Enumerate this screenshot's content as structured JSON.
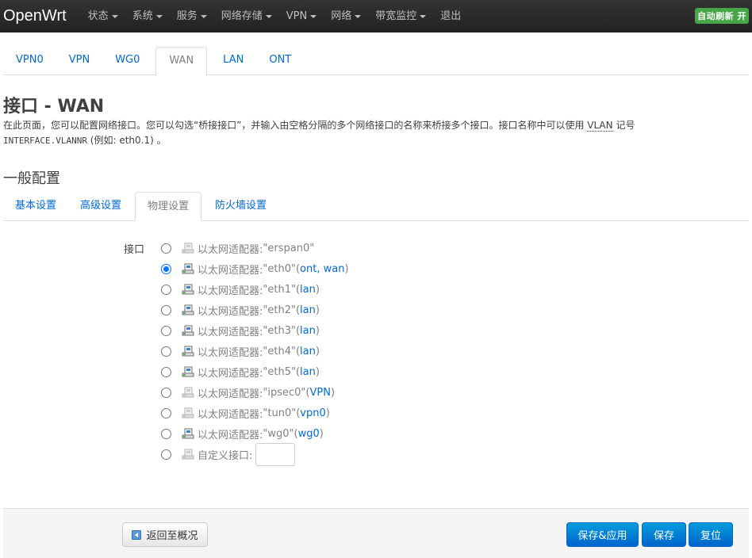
{
  "brand": "OpenWrt",
  "menu": [
    {
      "label": "状态",
      "dropdown": true
    },
    {
      "label": "系统",
      "dropdown": true
    },
    {
      "label": "服务",
      "dropdown": true
    },
    {
      "label": "网络存储",
      "dropdown": true
    },
    {
      "label": "VPN",
      "dropdown": true
    },
    {
      "label": "网络",
      "dropdown": true
    },
    {
      "label": "带宽监控",
      "dropdown": true
    },
    {
      "label": "退出",
      "dropdown": false
    }
  ],
  "autorefresh": "自动刷新 开",
  "interface_tabs": [
    "VPN0",
    "VPN",
    "WG0",
    "WAN",
    "LAN",
    "ONT"
  ],
  "active_interface_tab": "WAN",
  "page_title": "接口 - WAN",
  "description": {
    "part1": "在此页面，您可以配置网络接口。您可以勾选“桥接接口”，并输入由空格分隔的多个网络接口的名称来桥接多个接口。接口名称中可以使用 ",
    "abbr": "VLAN",
    "part2": " 记号",
    "mono": "INTERFACE.VLANNR",
    "part3": " (例如: eth0.1) 。"
  },
  "section_title": "一般配置",
  "sub_tabs": [
    "基本设置",
    "高级设置",
    "物理设置",
    "防火墙设置"
  ],
  "active_sub_tab": "物理设置",
  "field_label": "接口",
  "adapter_prefix": "以太网适配器: ",
  "options": [
    {
      "name": "\"erspan0\"",
      "nets": "",
      "checked": false,
      "icon": "ethernet-disabled-icon"
    },
    {
      "name": "\"eth0\"",
      "nets": "ont, wan",
      "checked": true,
      "icon": "ethernet-icon"
    },
    {
      "name": "\"eth1\"",
      "nets": "lan",
      "checked": false,
      "icon": "ethernet-icon"
    },
    {
      "name": "\"eth2\"",
      "nets": "lan",
      "checked": false,
      "icon": "ethernet-icon"
    },
    {
      "name": "\"eth3\"",
      "nets": "lan",
      "checked": false,
      "icon": "ethernet-icon"
    },
    {
      "name": "\"eth4\"",
      "nets": "lan",
      "checked": false,
      "icon": "ethernet-icon"
    },
    {
      "name": "\"eth5\"",
      "nets": "lan",
      "checked": false,
      "icon": "ethernet-icon"
    },
    {
      "name": "\"ipsec0\"",
      "nets": "VPN",
      "checked": false,
      "icon": "ethernet-disabled-icon"
    },
    {
      "name": "\"tun0\"",
      "nets": "vpn0",
      "checked": false,
      "icon": "ethernet-disabled-icon"
    },
    {
      "name": "\"wg0\"",
      "nets": "wg0",
      "checked": false,
      "icon": "ethernet-icon"
    }
  ],
  "custom_label": "自定义接口:",
  "custom_value": "",
  "buttons": {
    "back": "返回至概况",
    "save_apply": "保存&应用",
    "save": "保存",
    "reset": "复位"
  },
  "colors": {
    "link": "#0069d6",
    "primary": "#0064cd",
    "autorefresh": "#46a546"
  }
}
